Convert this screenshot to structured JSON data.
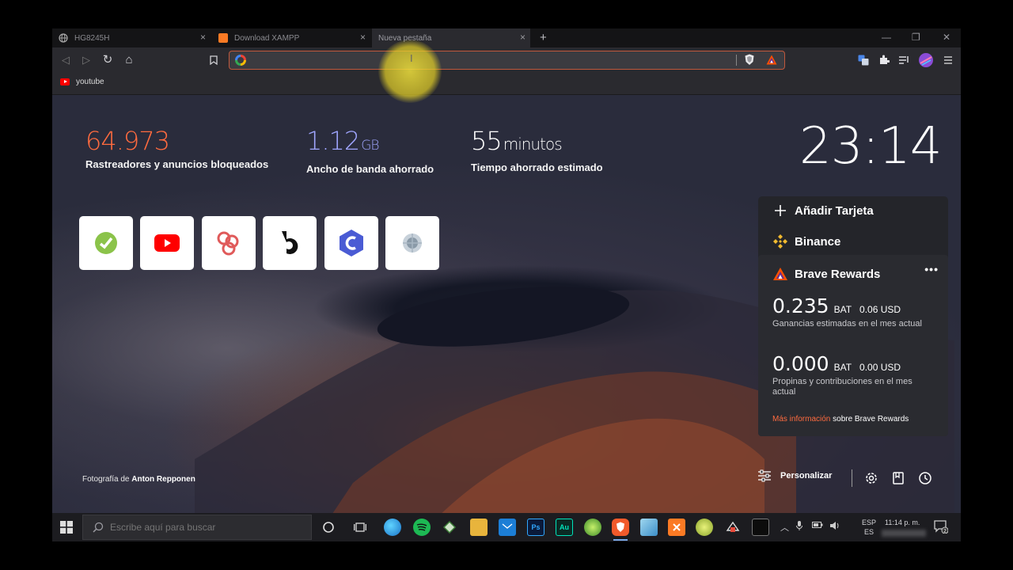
{
  "tabs": [
    {
      "title": "HG8245H",
      "close": "×"
    },
    {
      "title": "Download XAMPP",
      "close": "×"
    },
    {
      "title": "Nueva pestaña",
      "close": "×"
    }
  ],
  "tab_new": "+",
  "window_controls": {
    "minimize": "—",
    "maximize": "❐",
    "close": "✕"
  },
  "toolbar": {
    "back": "◁",
    "forward": "▷",
    "reload": "↻",
    "home": "⌂",
    "address_value": ""
  },
  "bookmarks": [
    {
      "label": "youtube"
    }
  ],
  "stats": {
    "trackers": {
      "value": "64.973",
      "label": "Rastreadores y anuncios bloqueados",
      "color": "#ff6b3f"
    },
    "bandwidth": {
      "value": "1.12",
      "unit": "GB",
      "label": "Ancho de banda ahorrado",
      "color": "#a0a6ff"
    },
    "time": {
      "value": "55",
      "unit": "minutos",
      "label": "Tiempo ahorrado estimado",
      "color": "#ffffff"
    }
  },
  "clock": "23:14",
  "top_sites": [
    {
      "name": "site-1-icon",
      "color": "#8bc34a"
    },
    {
      "name": "youtube-icon",
      "color": "#ff0000"
    },
    {
      "name": "circles-icon",
      "color": "#e05a5a"
    },
    {
      "name": "bitso-icon",
      "color": "#111111"
    },
    {
      "name": "c-hex-icon",
      "color": "#4a5bd4"
    },
    {
      "name": "emblem-icon",
      "color": "#8a9aa8"
    }
  ],
  "cards": {
    "add_card": "Añadir Tarjeta",
    "binance": "Binance",
    "rewards": {
      "title": "Brave Rewards",
      "more": "•••",
      "estimated": {
        "value": "0.235",
        "bat": "BAT",
        "usd": "0.06 USD",
        "desc": "Ganancias estimadas en el mes actual"
      },
      "tips": {
        "value": "0.000",
        "bat": "BAT",
        "usd": "0.00 USD",
        "desc": "Propinas y contribuciones en el mes actual"
      },
      "more_info_link": "Más información",
      "more_info_rest": " sobre Brave Rewards"
    }
  },
  "credit": {
    "prefix": "Fotografía de ",
    "author": "Anton Repponen"
  },
  "customize": "Personalizar",
  "taskbar": {
    "search_placeholder": "Escribe aquí para buscar",
    "lang_line1": "ESP",
    "lang_line2": "ES",
    "time": "11:14 p. m.",
    "notif_count": "2"
  }
}
